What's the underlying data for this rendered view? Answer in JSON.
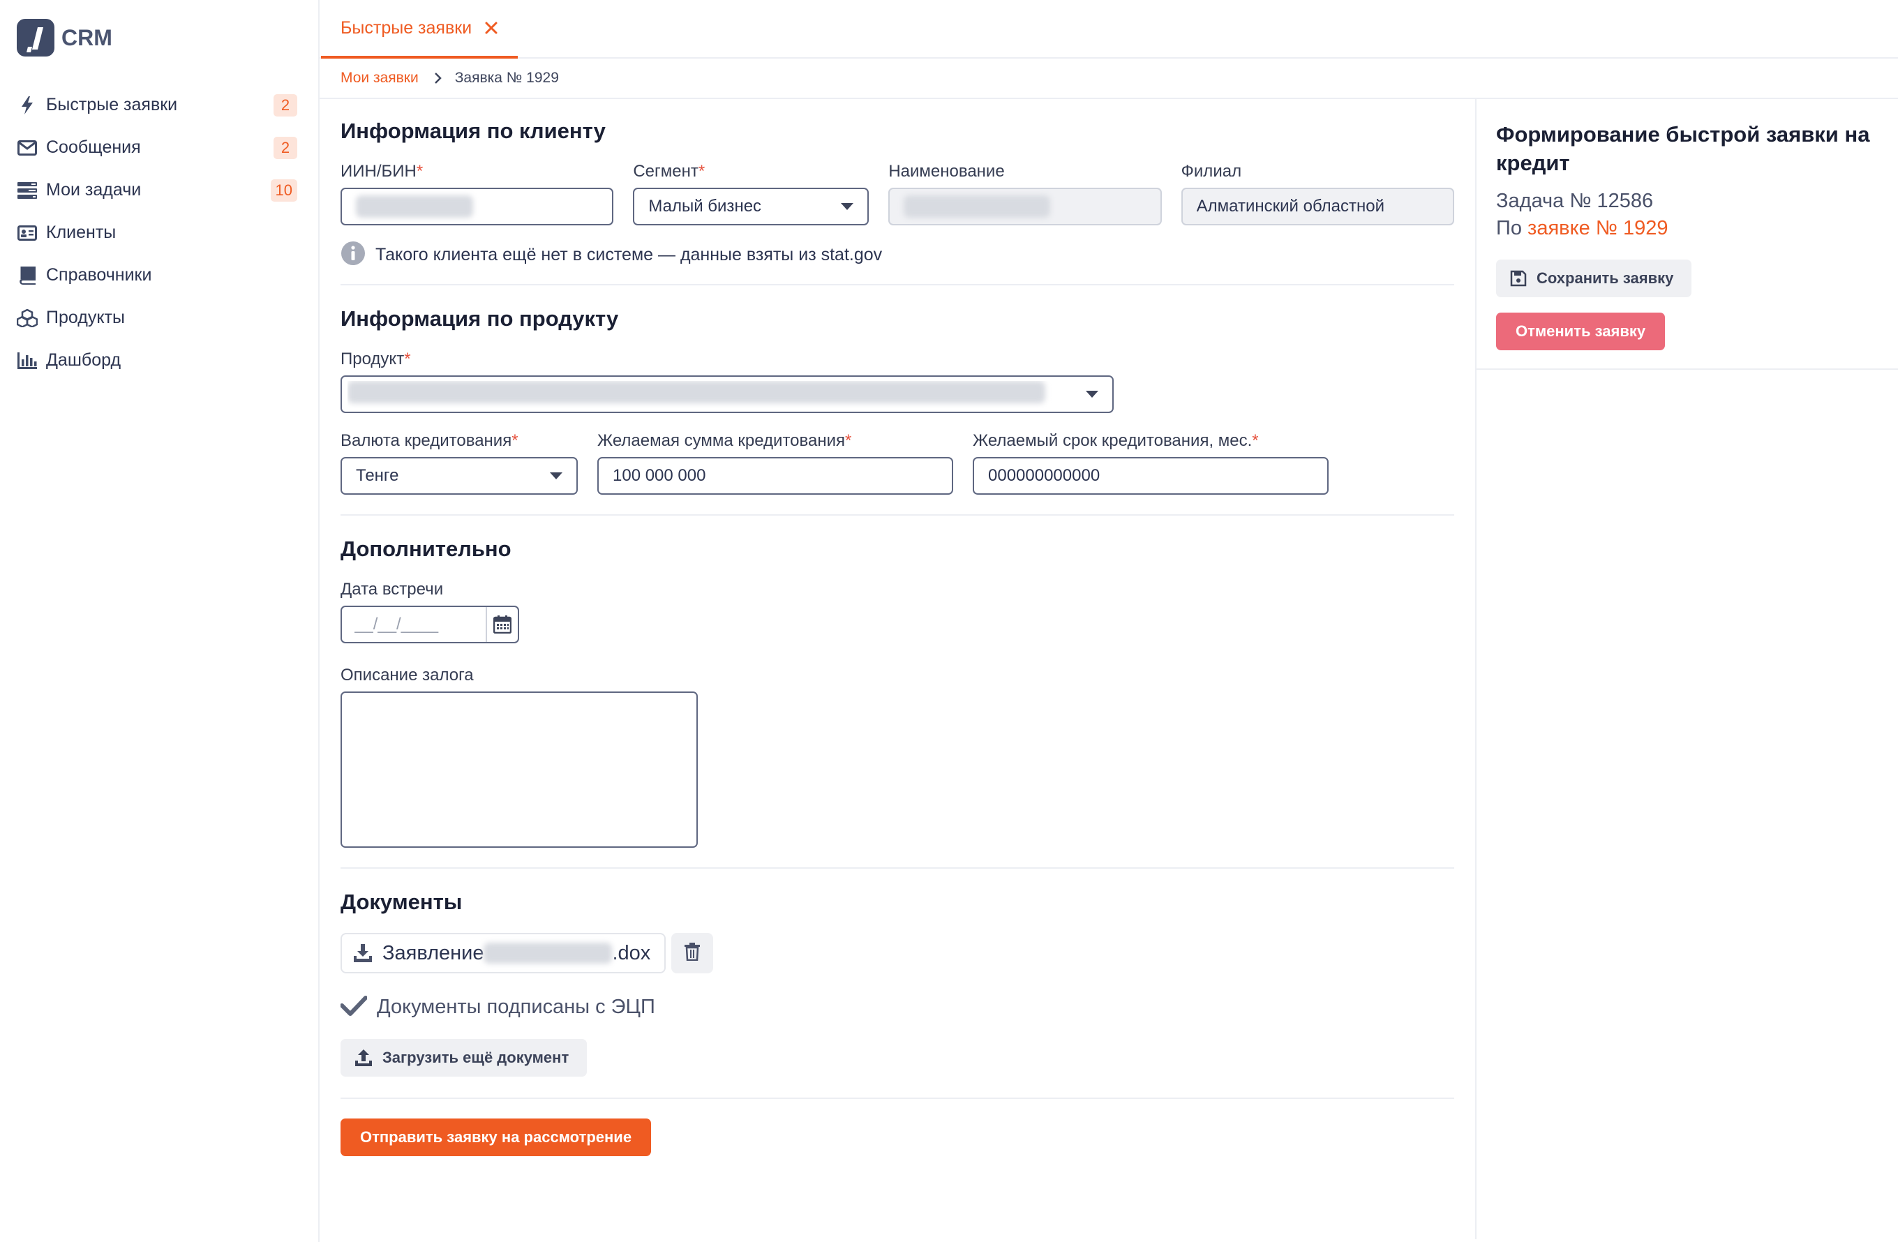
{
  "app": {
    "name": "CRM"
  },
  "sidebar": {
    "items": [
      {
        "label": "Быстрые заявки",
        "badge": "2",
        "icon": "lightning-icon"
      },
      {
        "label": "Сообщения",
        "badge": "2",
        "icon": "envelope-icon"
      },
      {
        "label": "Мои задачи",
        "badge": "10",
        "icon": "tasks-icon"
      },
      {
        "label": "Клиенты",
        "badge": "",
        "icon": "id-card-icon"
      },
      {
        "label": "Справочники",
        "badge": "",
        "icon": "book-icon"
      },
      {
        "label": "Продукты",
        "badge": "",
        "icon": "cubes-icon"
      },
      {
        "label": "Дашборд",
        "badge": "",
        "icon": "bar-chart-icon"
      }
    ]
  },
  "tabs": [
    {
      "label": "Быстрые заявки",
      "active": true
    }
  ],
  "breadcrumb": {
    "parent": "Мои заявки",
    "current": "Заявка № 1929"
  },
  "client": {
    "title": "Информация по клиенту",
    "iin_label": "ИИН/БИН",
    "segment_label": "Сегмент",
    "segment_value": "Малый бизнес",
    "name_label": "Наименование",
    "branch_label": "Филиал",
    "branch_value": "Алматинский областной",
    "info": "Такого клиента ещё нет в системе — данные взяты из stat.gov"
  },
  "product": {
    "title": "Информация по продукту",
    "product_label": "Продукт",
    "currency_label": "Валюта кредитования",
    "currency_value": "Тенге",
    "amount_label": "Желаемая сумма кредитования",
    "amount_value": "100 000 000",
    "term_label": "Желаемый срок кредитования, мес.",
    "term_value": "000000000000"
  },
  "extra": {
    "title": "Дополнительно",
    "date_label": "Дата встречи",
    "date_placeholder": "__/__/____",
    "collateral_label": "Описание залога"
  },
  "documents": {
    "title": "Документы",
    "file_prefix": "Заявление",
    "file_suffix": ".dox",
    "signed_text": "Документы подписаны с ЭЦП",
    "upload_label": "Загрузить ещё документ"
  },
  "submit_label": "Отправить заявку на рассмотрение",
  "panel": {
    "title": "Формирование быстрой заявки на кредит",
    "task": "Задача № 12586",
    "ref_prefix": "По",
    "ref_link": "заявке № 1929",
    "save_label": "Сохранить заявку",
    "cancel_label": "Отменить заявку"
  },
  "colors": {
    "accent": "#ef5b22",
    "danger": "#ec6a7a",
    "text": "#1a1f33",
    "sidebar_icon": "#3f4a66"
  }
}
